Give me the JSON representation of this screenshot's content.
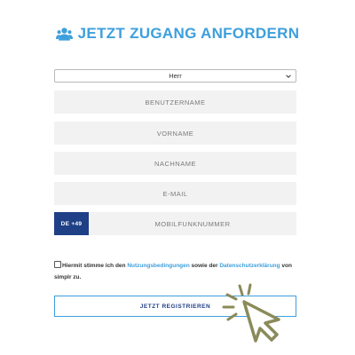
{
  "form": {
    "title": "JETZT ZUGANG ANFORDERN",
    "title_icon": "users-icon",
    "salutation_selected": "Herr",
    "fields": {
      "username_placeholder": "BENUTZERNAME",
      "firstname_placeholder": "VORNAME",
      "lastname_placeholder": "NACHNAME",
      "email_placeholder": "E-MAIL",
      "mobile_prefix": "DE +49",
      "mobile_placeholder": "MOBILFUNKNUMMER"
    },
    "consent": {
      "text_before": "Hiermit stimme ich den ",
      "terms_link": "Nutzungsbedingungen",
      "text_middle": " sowie der ",
      "privacy_link": "Datenschutzerklärung",
      "text_after": " von simplr zu."
    },
    "submit_label": "JETZT REGISTRIEREN"
  },
  "colors": {
    "accent": "#3d9fdc",
    "navy": "#1f3f86",
    "field_bg": "#f2f2f2",
    "cursor": "#8b8a5a"
  },
  "decor": {
    "cursor_icon": "click-cursor-icon"
  }
}
